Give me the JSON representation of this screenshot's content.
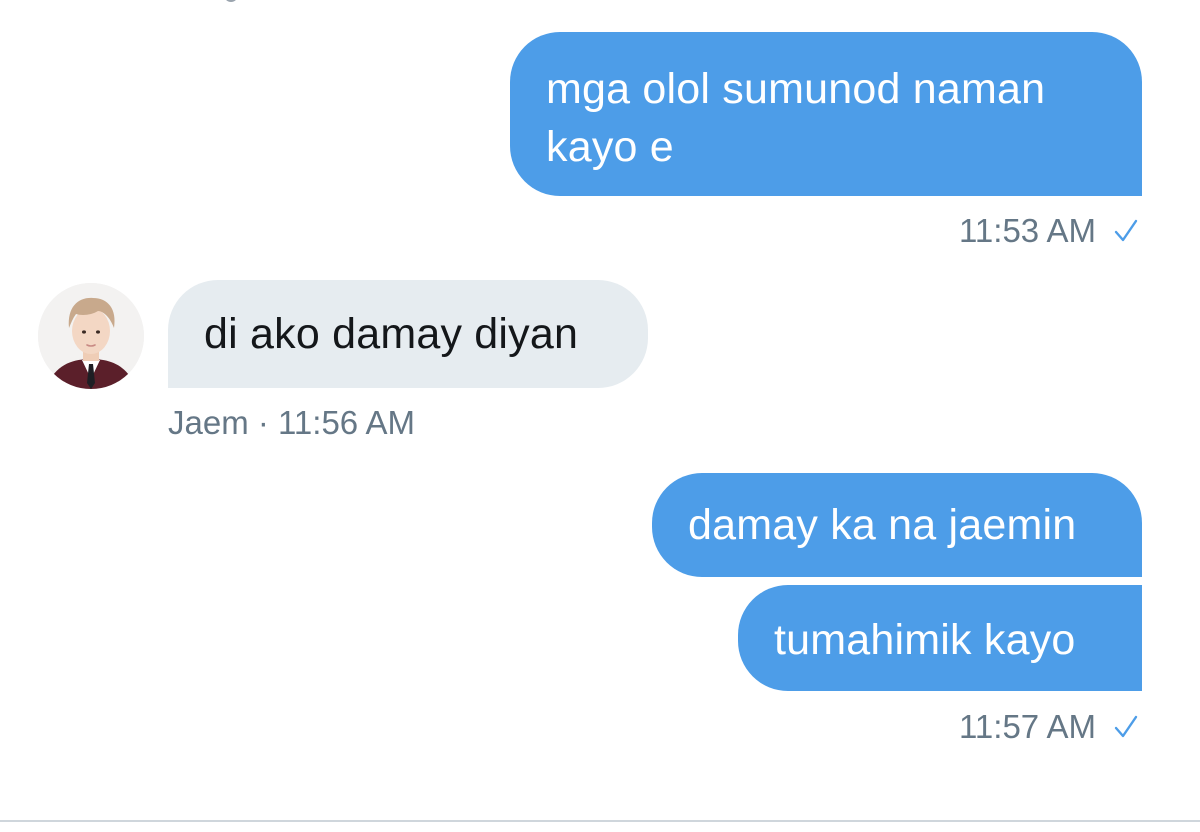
{
  "conversation": {
    "messages": [
      {
        "direction": "outgoing",
        "text": "mga olol sumunod naman kayo e"
      },
      {
        "direction": "incoming",
        "text": "di ako damay diyan",
        "sender": "Jaem"
      },
      {
        "direction": "outgoing",
        "text": "damay ka na jaemin"
      },
      {
        "direction": "outgoing",
        "text": "tumahimik kayo"
      }
    ],
    "meta": [
      {
        "time": "11:53 AM",
        "status_icon": "check-icon"
      },
      {
        "text": "Jaem · 11:56 AM"
      },
      {
        "time": "11:57 AM",
        "status_icon": "check-icon"
      }
    ]
  },
  "colors": {
    "outgoing_bubble": "#4d9de8",
    "incoming_bubble": "#e6ecf0",
    "meta_text": "#657786",
    "check": "#4d9de8"
  }
}
